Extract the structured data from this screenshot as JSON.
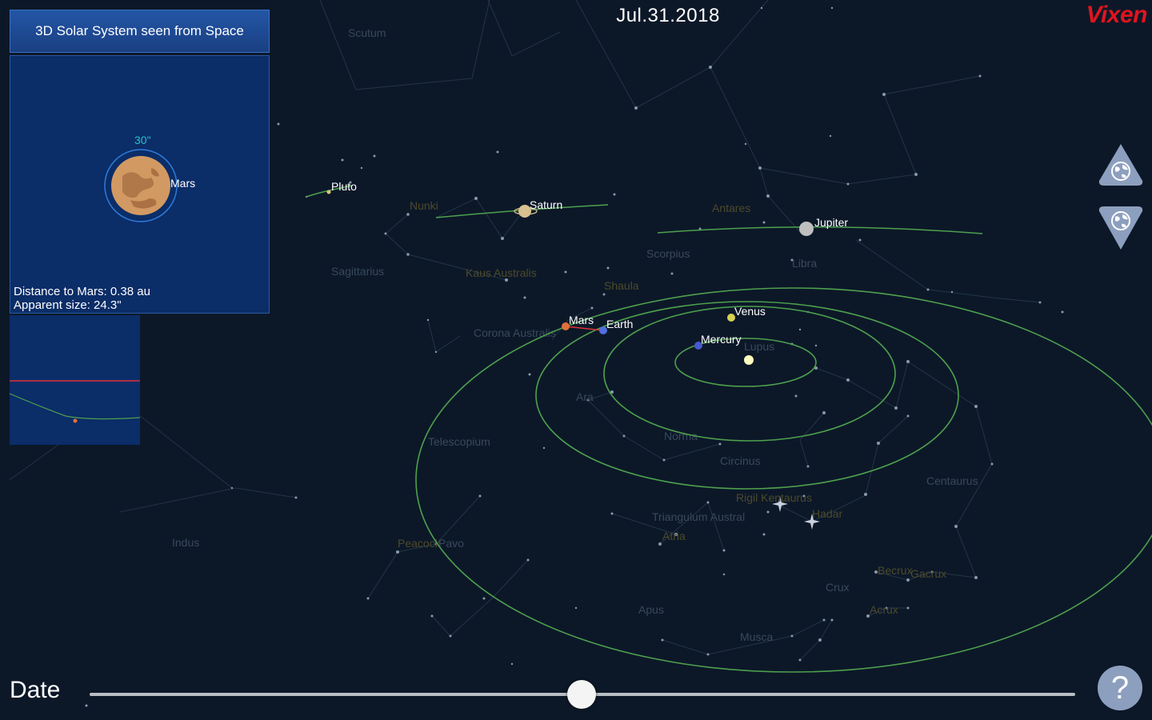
{
  "app": {
    "date": "Jul.31.2018",
    "brand": "Vixen"
  },
  "panel": {
    "title": "3D Solar System seen from Space",
    "target_label": "Mars",
    "scale_label": "30\"",
    "distance_text": "Distance to Mars: 0.38 au",
    "apparent_size_text": "Apparent size: 24.3\""
  },
  "controls": {
    "date_label": "Date",
    "date_slider_fraction": 0.5,
    "help_label": "?",
    "zoom_in_icon": "globe-up-icon",
    "zoom_out_icon": "globe-down-icon"
  },
  "planets": {
    "pluto": "Pluto",
    "saturn": "Saturn",
    "jupiter": "Jupiter",
    "mars": "Mars",
    "earth": "Earth",
    "venus": "Venus",
    "mercury": "Mercury"
  },
  "constellations": [
    "Scutum",
    "Nunki",
    "Antares",
    "Scorpius",
    "Libra",
    "Sagittarius",
    "Kaus Australis",
    "Shaula",
    "Corona Australis",
    "Lupus",
    "Ara",
    "Telescopium",
    "Norma",
    "Circinus",
    "Centaurus",
    "Rigil Kentaurus",
    "Hadar",
    "Triangulum Austral",
    "Atria",
    "Indus",
    "Peacock",
    "Pavo",
    "Becrux",
    "Gacrux",
    "Crux",
    "Acrux",
    "Apus",
    "Musca"
  ],
  "colors": {
    "sky": "#0c1828",
    "orbit": "#4ea04e",
    "panel": "#0b2d68",
    "brand": "#e0141e"
  }
}
